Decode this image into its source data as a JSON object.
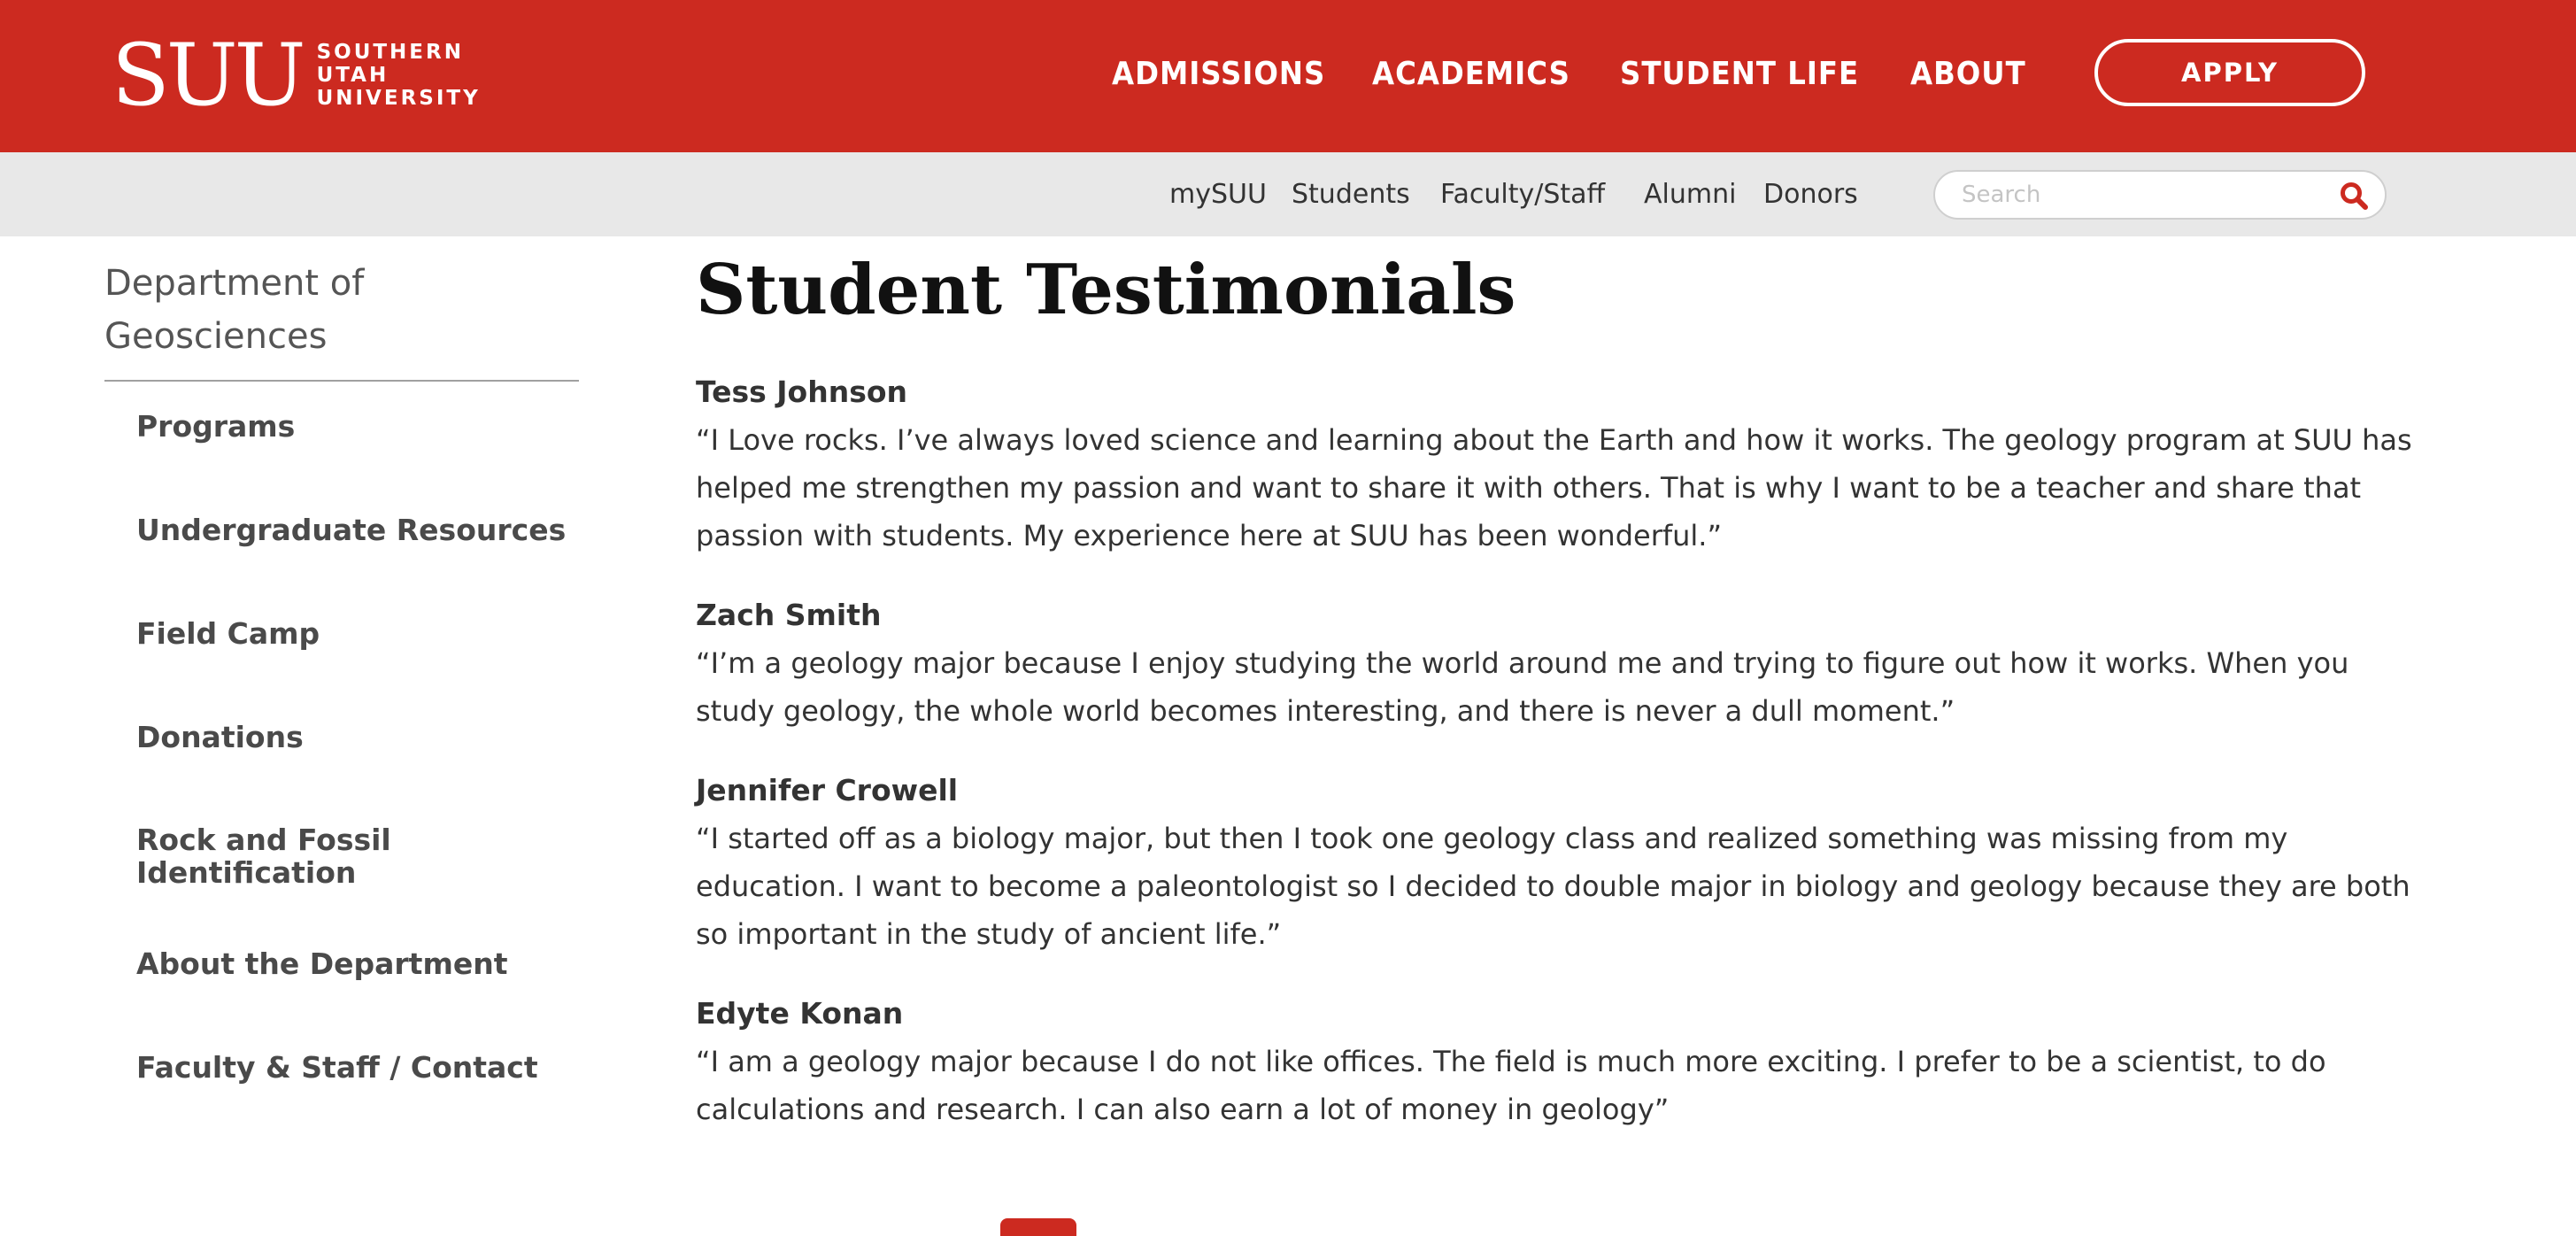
{
  "header": {
    "logo_mark": "SUU",
    "logo_lines": [
      "SOUTHERN",
      "UTAH",
      "UNIVERSITY"
    ],
    "nav": [
      {
        "label": "ADMISSIONS"
      },
      {
        "label": "ACADEMICS"
      },
      {
        "label": "STUDENT LIFE"
      },
      {
        "label": "ABOUT"
      }
    ],
    "apply_label": "APPLY",
    "colors": {
      "brand_red": "#cc2a20"
    }
  },
  "utility": {
    "links": [
      {
        "label": "mySUU"
      },
      {
        "label": "Students"
      },
      {
        "label": "Faculty/Staff"
      },
      {
        "label": "Alumni"
      },
      {
        "label": "Donors"
      }
    ],
    "search_placeholder": "Search",
    "search_icon": "search-icon"
  },
  "sidebar": {
    "title": "Department of Geosciences",
    "items": [
      {
        "label": "Programs"
      },
      {
        "label": "Undergraduate Resources"
      },
      {
        "label": "Field Camp"
      },
      {
        "label": "Donations"
      },
      {
        "label": "Rock and Fossil Identification"
      },
      {
        "label": "About the Department"
      },
      {
        "label": "Faculty & Staff / Contact"
      }
    ]
  },
  "main": {
    "title": "Student Testimonials",
    "testimonials": [
      {
        "name": "Tess Johnson",
        "quote": "“I Love rocks. I’ve always loved science and learning about the Earth and how it works. The geology program at SUU has helped me strengthen my passion and want to share it with others. That is why I want to be a teacher and share that passion with students. My experience here at SUU has been wonderful.”"
      },
      {
        "name": "Zach Smith",
        "quote": "“I’m a geology major because I enjoy studying the world around me and trying to figure out how it works. When you study geology, the whole world becomes interesting, and there is never a dull moment.”"
      },
      {
        "name": "Jennifer Crowell",
        "quote": "“I started off as a biology major, but then I took one geology class and realized something was missing from my education. I want to become a paleontologist so I decided to double major in biology and geology because they are both so important in the study of ancient life.”"
      },
      {
        "name": "Edyte Konan",
        "quote": "“I am a geology major because I do not like offices. The field is much more exciting. I prefer to be a scientist, to do calculations and research. I can also earn a lot of money in geology”"
      }
    ]
  }
}
